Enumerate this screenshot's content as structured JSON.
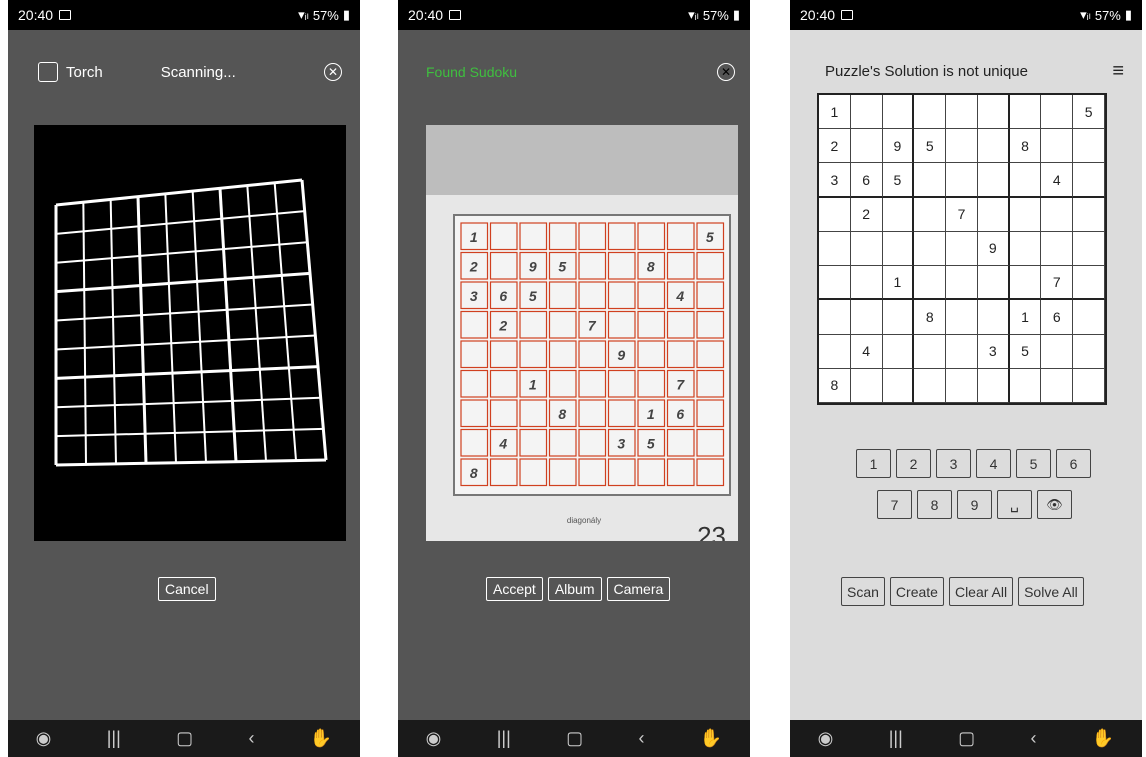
{
  "status": {
    "time": "20:40",
    "right": "57%"
  },
  "screen1": {
    "torch_label": "Torch",
    "status_text": "Scanning...",
    "cancel_label": "Cancel"
  },
  "screen2": {
    "found_text": "Found Sudoku",
    "accept_label": "Accept",
    "album_label": "Album",
    "camera_label": "Camera",
    "page_caption": "diagonály",
    "page_number": "23"
  },
  "screen3": {
    "title": "Puzzle's Solution is not unique",
    "grid": [
      [
        "1",
        "",
        "",
        "",
        "",
        "",
        "",
        "",
        "5"
      ],
      [
        "2",
        "",
        "9",
        "5",
        "",
        "",
        "8",
        "",
        ""
      ],
      [
        "3",
        "6",
        "5",
        "",
        "",
        "",
        "",
        "4",
        ""
      ],
      [
        "",
        "2",
        "",
        "",
        "7",
        "",
        "",
        "",
        ""
      ],
      [
        "",
        "",
        "",
        "",
        "",
        "9",
        "",
        "",
        ""
      ],
      [
        "",
        "",
        "1",
        "",
        "",
        "",
        "",
        "7",
        ""
      ],
      [
        "",
        "",
        "",
        "8",
        "",
        "",
        "1",
        "6",
        ""
      ],
      [
        "",
        "4",
        "",
        "",
        "",
        "3",
        "5",
        "",
        ""
      ],
      [
        "8",
        "",
        "",
        "",
        "",
        "",
        "",
        "",
        ""
      ]
    ],
    "numpad_row1": [
      "1",
      "2",
      "3",
      "4",
      "5",
      "6"
    ],
    "numpad_row2": [
      "7",
      "8",
      "9"
    ],
    "scan_label": "Scan",
    "create_label": "Create",
    "clear_label": "Clear All",
    "solve_label": "Solve All"
  },
  "colors": {
    "found": "#3fbf3f",
    "grid_line": "#d04020"
  }
}
